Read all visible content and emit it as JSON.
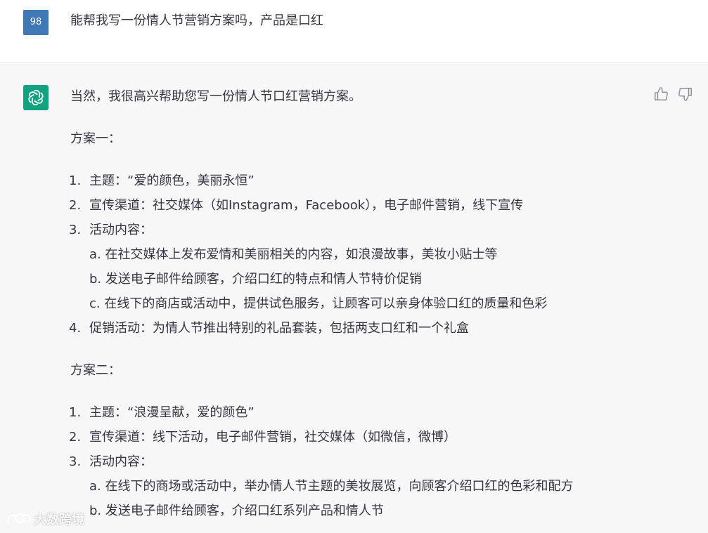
{
  "user_message": {
    "avatar_text": "98",
    "text": "能帮我写一份情人节营销方案吗，产品是口红"
  },
  "assistant_message": {
    "intro": "当然，我很高兴帮助您写一份情人节口红营销方案。",
    "plan1": {
      "heading": "方案一：",
      "items": [
        {
          "num": "1.",
          "text": "主题：“爱的颜色，美丽永恒”"
        },
        {
          "num": "2.",
          "text": "宣传渠道：社交媒体（如Instagram，Facebook），电子邮件营销，线下宣传"
        },
        {
          "num": "3.",
          "text": "活动内容："
        },
        {
          "num": "4.",
          "text": "促销活动：为情人节推出特别的礼品套装，包括两支口红和一个礼盒"
        }
      ],
      "sub_items": [
        "a. 在社交媒体上发布爱情和美丽相关的内容，如浪漫故事，美妆小贴士等",
        "b. 发送电子邮件给顾客，介绍口红的特点和情人节特价促销",
        "c. 在线下的商店或活动中，提供试色服务，让顾客可以亲身体验口红的质量和色彩"
      ]
    },
    "plan2": {
      "heading": "方案二：",
      "items": [
        {
          "num": "1.",
          "text": "主题：“浪漫呈献，爱的颜色”"
        },
        {
          "num": "2.",
          "text": "宣传渠道：线下活动，电子邮件营销，社交媒体（如微信，微博）"
        },
        {
          "num": "3.",
          "text": "活动内容："
        }
      ],
      "sub_items": [
        "a. 在线下的商场或活动中，举办情人节主题的美妆展览，向顾客介绍口红的色彩和配方",
        "b. 发送电子邮件给顾客，介绍口红系列产品和情人节"
      ]
    }
  },
  "watermark_text": "大数跨境",
  "colors": {
    "user_avatar": "#3f79b5",
    "assistant_avatar": "#10a37f",
    "assistant_bg": "#f7f7f8",
    "text": "#343541",
    "icon": "#8e8ea0"
  },
  "icons": {
    "assistant": "openai-logo-icon",
    "feedback_up": "thumbs-up-icon",
    "feedback_down": "thumbs-down-icon",
    "watermark": "watermark-logo-icon"
  }
}
